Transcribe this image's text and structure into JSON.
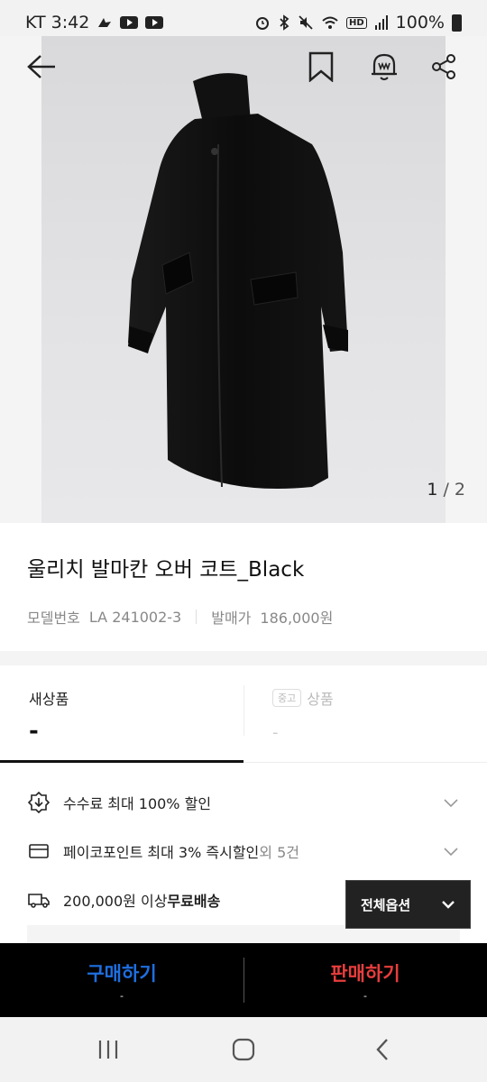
{
  "status_bar": {
    "carrier_time": "KT 3:42",
    "battery": "100%",
    "icons": [
      "bird-icon",
      "youtube-icon",
      "youtube-icon",
      "alarm-icon",
      "bluetooth-icon",
      "mute-icon",
      "wifi-icon",
      "hd-icon",
      "signal-icon",
      "battery-icon"
    ]
  },
  "gallery": {
    "current": "1",
    "separator": "/",
    "total": "2"
  },
  "header_icons": [
    "back-arrow-icon",
    "bookmark-icon",
    "bell-icon",
    "share-icon"
  ],
  "product": {
    "title": "울리치 발마칸 오버 코트_Black",
    "model_label": "모델번호",
    "model_value": "LA 241002-3",
    "release_label": "발매가",
    "release_value": "186,000원"
  },
  "tabs": {
    "new": {
      "label": "새상품",
      "price": "-"
    },
    "used": {
      "badge": "중고",
      "label": "상품",
      "price": "-"
    }
  },
  "benefits": {
    "fee": {
      "text": "수수료 최대 100% 할인"
    },
    "point": {
      "text": "페이코포인트 최대 3% 즉시할인",
      "extra": " 외 5건"
    },
    "shipping": {
      "text": "200,000원 이상 ",
      "bold": "무료배송"
    }
  },
  "all_options": {
    "label": "전체옵션"
  },
  "actions": {
    "buy": {
      "label": "구매하기",
      "sub": "-"
    },
    "sell": {
      "label": "판매하기",
      "sub": "-"
    }
  },
  "colors": {
    "buy": "#1e6fe0",
    "sell": "#e83d3d",
    "action_bar": "#000000"
  }
}
